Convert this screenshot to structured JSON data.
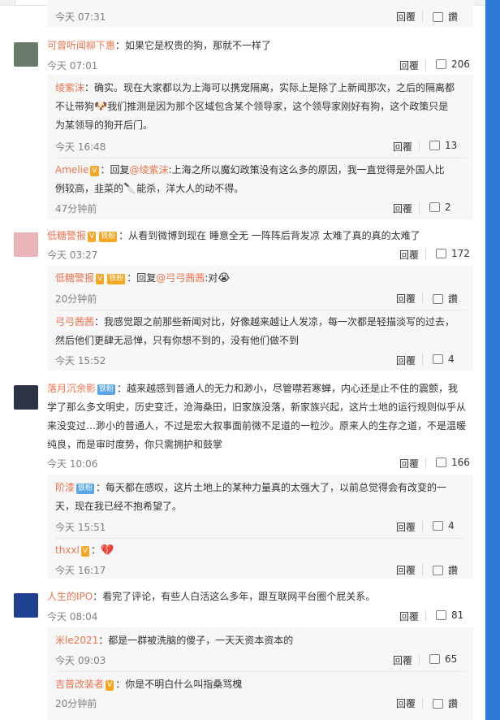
{
  "comments": {
    "top_partial": {
      "time": "今天 07:31",
      "reply": "回覆",
      "like": "讚"
    },
    "c1": {
      "user": "可曾听闻柳下惠",
      "text": "：如果它是权贵的狗，那就不一样了",
      "time": "今天 07:01",
      "reply": "回覆",
      "likes": "206"
    },
    "c1r1": {
      "user": "绫紫沫",
      "line1": "：确实。现在大家都以为上海可以携宠隔离，实际上是除了上新闻那次，之后的隔离都",
      "line2a": "不让带狗",
      "line2b": "我们推测是因为那个区域包含某个领导家，这个领导家刚好有狗，这个政策只是",
      "line3": "为某领导的狗开后门。",
      "time": "今天 16:48",
      "reply": "回覆",
      "likes": "13"
    },
    "c1r2": {
      "user": "Amelie",
      "sep": "：回复",
      "mention": "@绫紫沫",
      "line1": ":上海之所以魔幻政策没有这么多的原因，我一直觉得是外国人比",
      "line2": "例较高，韭菜的",
      "line2b": "能杀，洋大人的动不得。",
      "time": "47分钟前",
      "reply": "回覆",
      "likes": "2"
    },
    "c2": {
      "user": "低糖警报",
      "badge": "铁粉",
      "text": "：从看到微博到现在 睡意全无 一阵阵后背发凉 太难了真的真的太难了",
      "time": "今天 03:27",
      "reply": "回覆",
      "likes": "172"
    },
    "c2r1": {
      "user": "低糖警报",
      "badge": "铁粉",
      "sep": "：回复",
      "mention": "@弓弓茜茜",
      "text": ":对",
      "time": "20分钟前",
      "reply": "回覆",
      "like": "讚"
    },
    "c2r2": {
      "user": "弓弓茜茜",
      "line1": "：我感觉跟之前那些新闻对比，好像越来越让人发凉，每一次都是轻描淡写的过去，",
      "line2": "然后他们更肆无忌惮，只有你想不到的，没有他们做不到",
      "time": "今天 15:52",
      "reply": "回覆",
      "likes": "4"
    },
    "c3": {
      "user": "落月沉余影",
      "badge": "铁粉",
      "line1": "：越来越感到普通人的无力和渺小，尽管噤若寒蝉，内心还是止不住的震颤，我",
      "line2": "学了那么多文明史，历史变迁，沧海桑田，旧家族没落，新家族兴起，这片土地的运行规则似乎从",
      "line3": "来没变过…渺小的普通人，不过是宏大叙事面前微不足道的一粒沙。原来人的生存之道，不是温暖",
      "line4": "纯良，而是审时度势，你只需拥护和鼓掌",
      "time": "今天 10:06",
      "reply": "回覆",
      "likes": "166"
    },
    "c3r1": {
      "user": "阶漆",
      "badge": "铁粉",
      "line1": "：每天都在感叹，这片土地上的某种力量真的太强大了，以前总觉得会有改变的一",
      "line2": "天，现在我已经不抱希望了。",
      "time": "今天 15:51",
      "reply": "回覆",
      "likes": "4"
    },
    "c3r2": {
      "user": "thxxl",
      "text": "：",
      "time": "今天 16:17",
      "reply": "回覆",
      "like": "讚"
    },
    "c4": {
      "user": "人生的IPO",
      "text": "：看完了评论，有些人白活这么多年，跟互联网平台圈个屁关系。",
      "time": "今天 08:04",
      "reply": "回覆",
      "likes": "81"
    },
    "c4r1": {
      "user": "米le2021",
      "text": "：都是一群被洗脑的傻子，一天天资本资本的",
      "time": "今天 09:03",
      "reply": "回覆",
      "likes": "65"
    },
    "c4r2": {
      "user": "吉普改装者",
      "text": "：你是不明白什么叫指桑骂槐",
      "time": "20分钟前",
      "reply": "回覆",
      "like": "讚"
    }
  }
}
